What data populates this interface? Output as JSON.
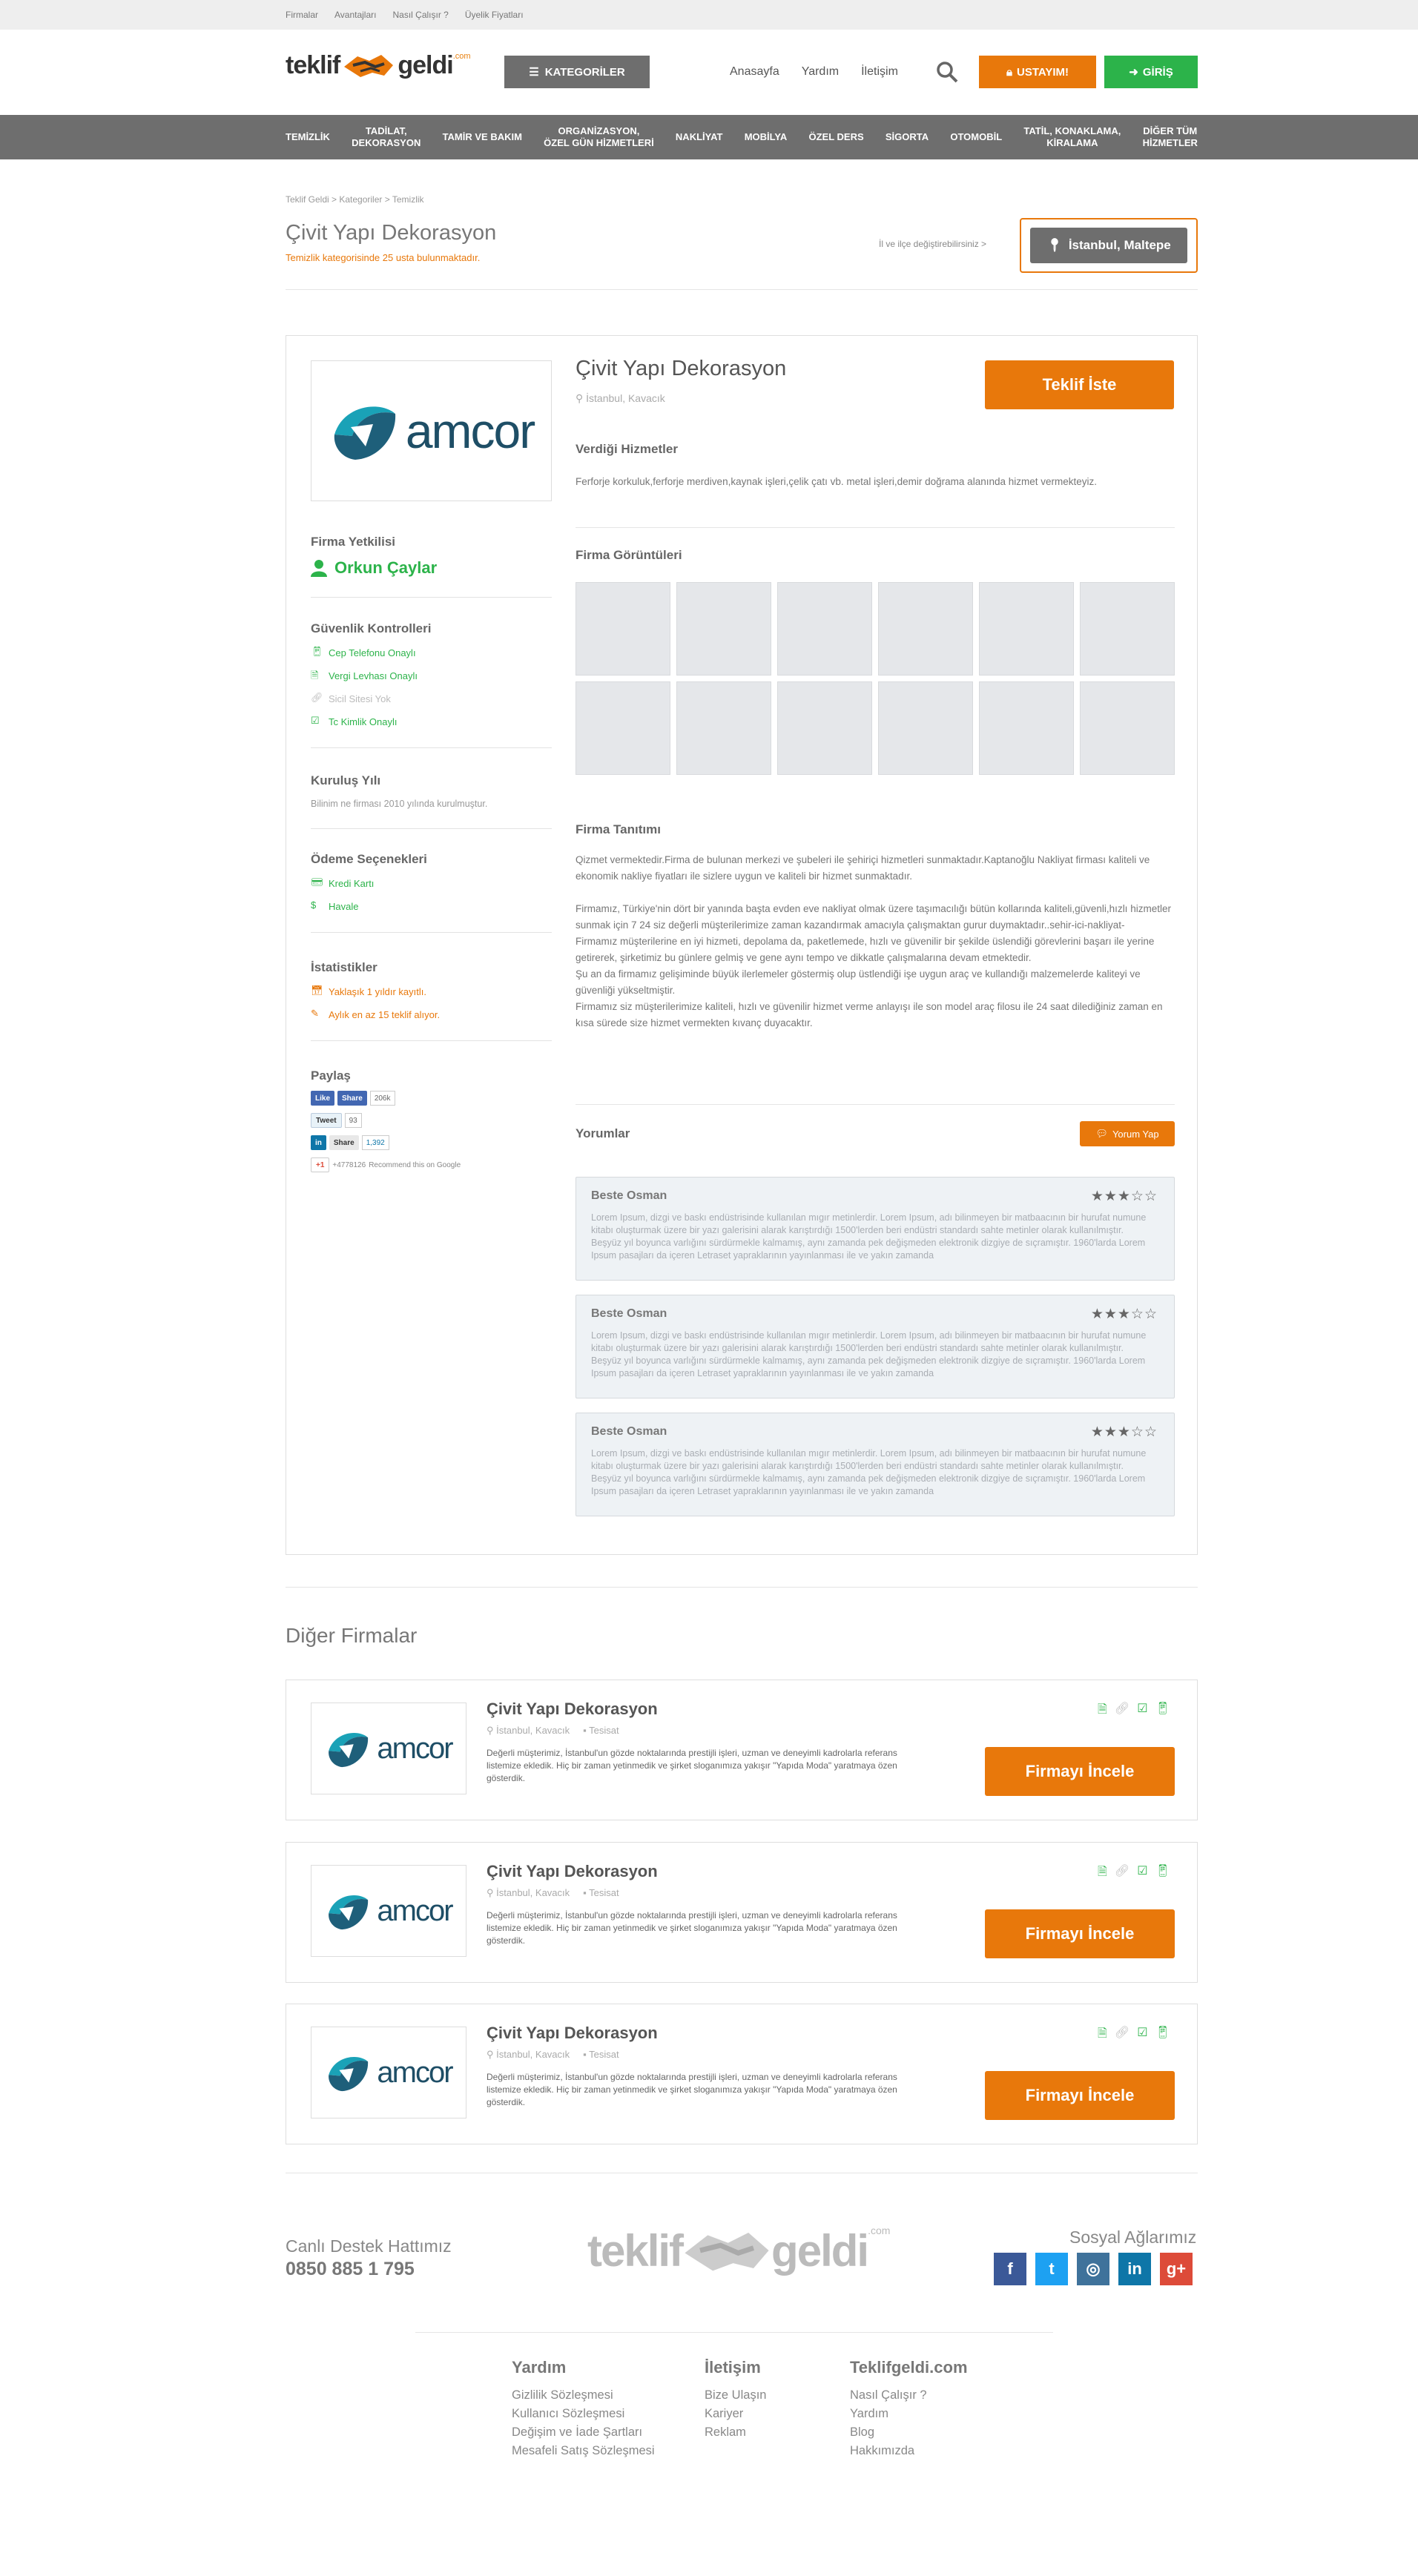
{
  "topbar": {
    "links": [
      "Firmalar",
      "Avantajları",
      "Nasıl Çalışır ?",
      "Üyelik Fiyatları"
    ]
  },
  "logo": {
    "part1": "teklif",
    "part2": "geldi",
    "suffix": ".com"
  },
  "header": {
    "categories_btn": "KATEGORİLER",
    "nav": [
      "Anasayfa",
      "Yardım",
      "İletişim"
    ],
    "ustayim_btn": "USTAYIM!",
    "giris_btn": "GİRİŞ"
  },
  "catnav": [
    "TEMİZLİK",
    "TADİLAT,\nDEKORASYON",
    "TAMİR VE BAKIM",
    "ORGANİZASYON,\nÖZEL GÜN HİZMETLERİ",
    "NAKLİYAT",
    "MOBİLYA",
    "ÖZEL DERS",
    "SİGORTA",
    "OTOMOBİL",
    "TATİL, KONAKLAMA,\nKİRALAMA",
    "DİĞER TÜM\nHİZMETLER"
  ],
  "breadcrumb": "Teklif Geldi > Kategoriler > Temizlik",
  "page": {
    "title": "Çivit Yapı Dekorasyon",
    "subtitle": "Temizlik kategorisinde 25 usta bulunmaktadır.",
    "location_question": "İl ve ilçe değiştirebilirsiniz >",
    "location_btn": "İstanbul, Maltepe"
  },
  "company": {
    "logo_text": "amcor",
    "name": "Çivit Yapı Dekorasyon",
    "location": "İstanbul, Kavacık",
    "quote_btn": "Teklif İste",
    "services_title": "Verdiği Hizmetler",
    "services_text": "Ferforje korkuluk,ferforje merdiven,kaynak işleri,çelik çatı vb. metal işleri,demir doğrama alanında hizmet vermekteyiz.",
    "gallery_title": "Firma Görüntüleri",
    "intro_title": "Firma Tanıtımı",
    "intro_text": "Qizmet vermektedir.Firma de bulunan merkezi ve şubeleri ile şehiriçi hizmetleri sunmaktadır.Kaptanoğlu Nakliyat firması kaliteli ve ekonomik nakliye fiyatları ile sizlere uygun ve kaliteli bir hizmet sunmaktadır.\n\nFirmamız, Türkiye'nin dört bir yanında başta evden eve nakliyat olmak üzere taşımacılığı bütün kollarında kaliteli,güvenli,hızlı hizmetler sunmak için 7 24 siz değerli müşterilerimize zaman kazandırmak amacıyla çalışmaktan gurur duymaktadır..sehir-ici-nakliyat-\nFirmamız müşterilerine en iyi hizmeti, depolama da, paketlemede, hızlı ve güvenilir bir şekilde üslendiği görevlerini başarı ile yerine getirerek, şirketimiz bu günlere gelmiş ve gene aynı tempo ve dikkatle çalışmalarına devam etmektedir.\nŞu an da firmamız gelişiminde büyük ilerlemeler göstermiş olup üstlendiği işe uygun araç ve kullandığı malzemelerde kaliteyi ve güvenliği yükseltmiştir.\nFirmamız siz müşterilerimize kaliteli, hızlı ve güvenilir hizmet verme anlayışı ile son model araç filosu ile 24 saat dilediğiniz zaman en kısa sürede size hizmet vermekten kıvanç duyacaktır.",
    "reviews_title": "Yorumlar",
    "review_btn": "Yorum Yap"
  },
  "sidebar": {
    "official_title": "Firma Yetkilisi",
    "official_name": "Orkun Çaylar",
    "security_title": "Güvenlik Kontrolleri",
    "security": [
      "Cep Telefonu Onaylı",
      "Vergi Levhası Onaylı",
      "Sicil Sitesi Yok",
      "Tc Kimlik Onaylı"
    ],
    "founded_title": "Kuruluş Yılı",
    "founded_text": "Bilinim ne firması 2010 yılında kurulmuştur.",
    "payment_title": "Ödeme Seçenekleri",
    "payment": [
      "Kredi Kartı",
      "Havale"
    ],
    "stats_title": "İstatistikler",
    "stats": [
      "Yaklaşık 1 yıldır kayıtlı.",
      "Aylık en az 15 teklif alıyor."
    ],
    "share_title": "Paylaş",
    "share": {
      "fb_like": "Like",
      "fb_share": "Share",
      "fb_count": "206k",
      "tweet": "Tweet",
      "tweet_count": "93",
      "in_share": "Share",
      "in_count": "1,392",
      "g_plus": "+1",
      "g_count": "+4778126",
      "g_text": "Recommend this on Google"
    }
  },
  "reviews": [
    {
      "name": "Beste Osman",
      "stars": "★★★☆☆",
      "text": "Lorem Ipsum, dizgi ve baskı endüstrisinde kullanılan mıgır metinlerdir. Lorem Ipsum, adı bilinmeyen bir matbaacının bir hurufat numune kitabı oluşturmak üzere bir yazı galerisini alarak karıştırdığı 1500'lerden beri endüstri standardı sahte metinler olarak kullanılmıştır. Beşyüz yıl boyunca varlığını sürdürmekle kalmamış, aynı zamanda pek değişmeden elektronik dizgiye de sıçramıştır. 1960'larda Lorem Ipsum pasajları da içeren Letraset yapraklarının yayınlanması ile ve yakın zamanda"
    },
    {
      "name": "Beste Osman",
      "stars": "★★★☆☆",
      "text": "Lorem Ipsum, dizgi ve baskı endüstrisinde kullanılan mıgır metinlerdir. Lorem Ipsum, adı bilinmeyen bir matbaacının bir hurufat numune kitabı oluşturmak üzere bir yazı galerisini alarak karıştırdığı 1500'lerden beri endüstri standardı sahte metinler olarak kullanılmıştır. Beşyüz yıl boyunca varlığını sürdürmekle kalmamış, aynı zamanda pek değişmeden elektronik dizgiye de sıçramıştır. 1960'larda Lorem Ipsum pasajları da içeren Letraset yapraklarının yayınlanması ile ve yakın zamanda"
    },
    {
      "name": "Beste Osman",
      "stars": "★★★☆☆",
      "text": "Lorem Ipsum, dizgi ve baskı endüstrisinde kullanılan mıgır metinlerdir. Lorem Ipsum, adı bilinmeyen bir matbaacının bir hurufat numune kitabı oluşturmak üzere bir yazı galerisini alarak karıştırdığı 1500'lerden beri endüstri standardı sahte metinler olarak kullanılmıştır. Beşyüz yıl boyunca varlığını sürdürmekle kalmamış, aynı zamanda pek değişmeden elektronik dizgiye de sıçramıştır. 1960'larda Lorem Ipsum pasajları da içeren Letraset yapraklarının yayınlanması ile ve yakın zamanda"
    }
  ],
  "other": {
    "title": "Diğer Firmalar",
    "items": [
      {
        "logo": "amcor",
        "name": "Çivit Yapı Dekorasyon",
        "location": "İstanbul, Kavacık",
        "category": "Tesisat",
        "desc": "Değerli müşterimiz, İstanbul'un gözde noktalarında prestijli işleri, uzman ve deneyimli kadrolarla referans listemize ekledik. Hiç bir zaman yetinmedik ve şirket sloganımıza yakışır \"Yapıda Moda\" yaratmaya özen gösterdik.",
        "btn": "Firmayı İncele"
      },
      {
        "logo": "amcor",
        "name": "Çivit Yapı Dekorasyon",
        "location": "İstanbul, Kavacık",
        "category": "Tesisat",
        "desc": "Değerli müşterimiz, İstanbul'un gözde noktalarında prestijli işleri, uzman ve deneyimli kadrolarla referans listemize ekledik. Hiç bir zaman yetinmedik ve şirket sloganımıza yakışır \"Yapıda Moda\" yaratmaya özen gösterdik.",
        "btn": "Firmayı İncele"
      },
      {
        "logo": "amcor",
        "name": "Çivit Yapı Dekorasyon",
        "location": "İstanbul, Kavacık",
        "category": "Tesisat",
        "desc": "Değerli müşterimiz, İstanbul'un gözde noktalarında prestijli işleri, uzman ve deneyimli kadrolarla referans listemize ekledik. Hiç bir zaman yetinmedik ve şirket sloganımıza yakışır \"Yapıda Moda\" yaratmaya özen gösterdik.",
        "btn": "Firmayı İncele"
      }
    ]
  },
  "footer": {
    "support_label": "Canlı Destek Hattımız",
    "phone": "0850 885 1 795",
    "social_label": "Sosyal Ağlarımız",
    "social": [
      {
        "icon": "facebook-icon",
        "glyph": "f",
        "color": "#3b5998"
      },
      {
        "icon": "twitter-icon",
        "glyph": "t",
        "color": "#1da1f2"
      },
      {
        "icon": "instagram-icon",
        "glyph": "◎",
        "color": "#3f729b"
      },
      {
        "icon": "linkedin-icon",
        "glyph": "in",
        "color": "#0e76a8"
      },
      {
        "icon": "googleplus-icon",
        "glyph": "g+",
        "color": "#dd4b39"
      }
    ],
    "cols": [
      {
        "title": "Yardım",
        "links": [
          "Gizlilik Sözleşmesi",
          "Kullanıcı Sözleşmesi",
          "Değişim ve İade Şartları",
          "Mesafeli Satış Sözleşmesi"
        ]
      },
      {
        "title": "İletişim",
        "links": [
          "Bize Ulaşın",
          "Kariyer",
          "Reklam"
        ]
      },
      {
        "title": "Teklifgeldi.com",
        "links": [
          "Nasıl Çalışır ?",
          "Yardım",
          "Blog",
          "Hakkımızda"
        ]
      }
    ]
  },
  "colors": {
    "orange": "#e8780b",
    "green": "#2cb34a",
    "grey_bar": "#6e6e6e"
  }
}
